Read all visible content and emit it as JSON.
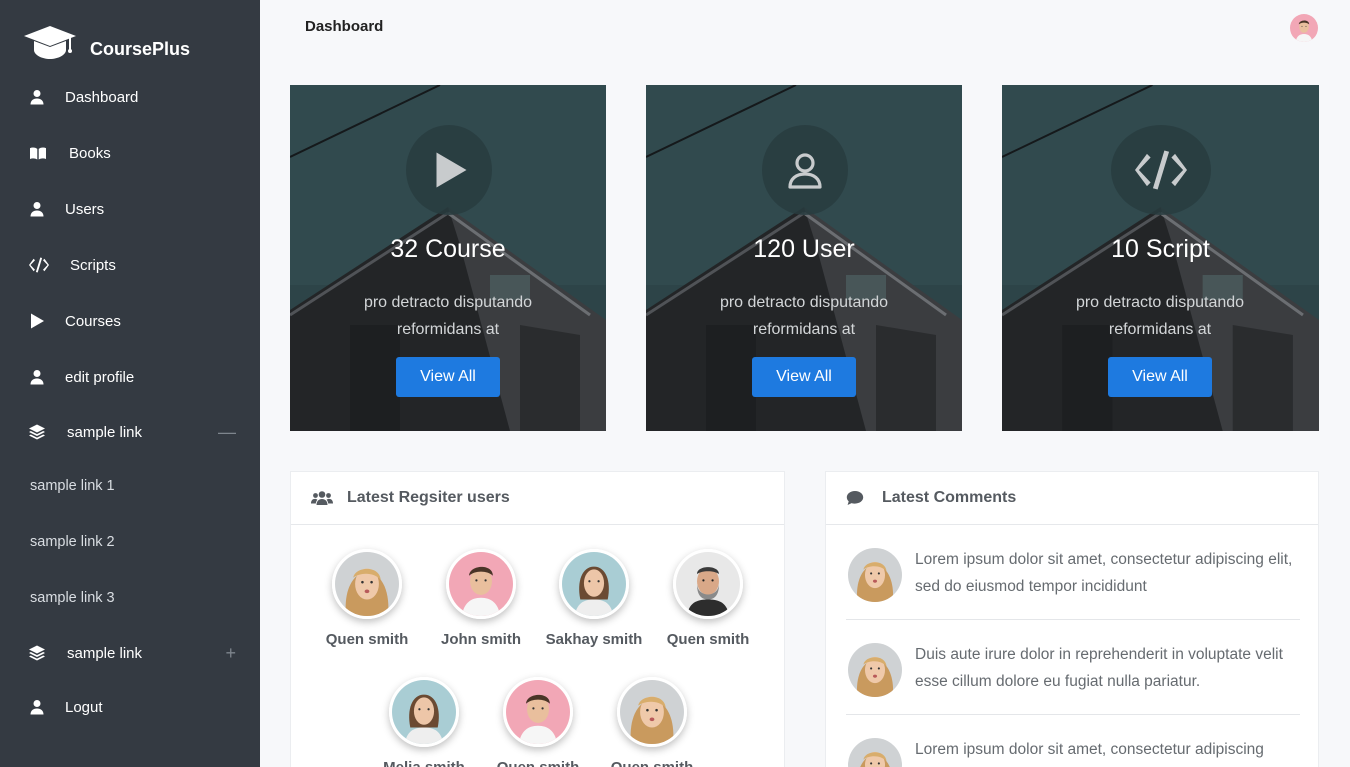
{
  "brand": {
    "name": "CoursePlus"
  },
  "sidebar": {
    "items": [
      {
        "label": "Dashboard",
        "icon": "user-icon"
      },
      {
        "label": "Books",
        "icon": "book-icon"
      },
      {
        "label": "Users",
        "icon": "user-icon"
      },
      {
        "label": "Scripts",
        "icon": "code-icon"
      },
      {
        "label": "Courses",
        "icon": "play-icon"
      },
      {
        "label": "edit profile",
        "icon": "user-icon"
      },
      {
        "label": "sample link",
        "icon": "layers-icon",
        "toggle": "—"
      },
      {
        "label": "sample link 1"
      },
      {
        "label": "sample link 2"
      },
      {
        "label": "sample link 3"
      },
      {
        "label": "sample link",
        "icon": "layers-icon",
        "toggle": "+"
      },
      {
        "label": "Logut",
        "icon": "user-icon"
      }
    ]
  },
  "header": {
    "title": "Dashboard"
  },
  "stats": [
    {
      "count": "32 Course",
      "desc": "pro detracto disputando reformidans at",
      "button": "View All",
      "icon": "play-icon"
    },
    {
      "count": "120 User",
      "desc": "pro detracto disputando reformidans at",
      "button": "View All",
      "icon": "user-outline-icon"
    },
    {
      "count": "10 Script",
      "desc": "pro detracto disputando reformidans at",
      "button": "View All",
      "icon": "code-icon"
    }
  ],
  "users_panel": {
    "title": "Latest Regsiter users",
    "users": [
      {
        "name": "Quen smith"
      },
      {
        "name": "John smith"
      },
      {
        "name": "Sakhay smith"
      },
      {
        "name": "Quen smith"
      },
      {
        "name": "Melia smith"
      },
      {
        "name": "Quen smith"
      },
      {
        "name": "Quen smith"
      }
    ]
  },
  "comments_panel": {
    "title": "Latest Comments",
    "comments": [
      {
        "text": "Lorem ipsum dolor sit amet, consectetur adipiscing elit, sed do eiusmod tempor incididunt"
      },
      {
        "text": "Duis aute irure dolor in reprehenderit in voluptate velit esse cillum dolore eu fugiat nulla pariatur."
      },
      {
        "text": "Lorem ipsum dolor sit amet, consectetur adipiscing"
      }
    ]
  },
  "colors": {
    "sidebar": "#343a42",
    "accent": "#1e7ae0",
    "background": "#f7f8fa"
  }
}
